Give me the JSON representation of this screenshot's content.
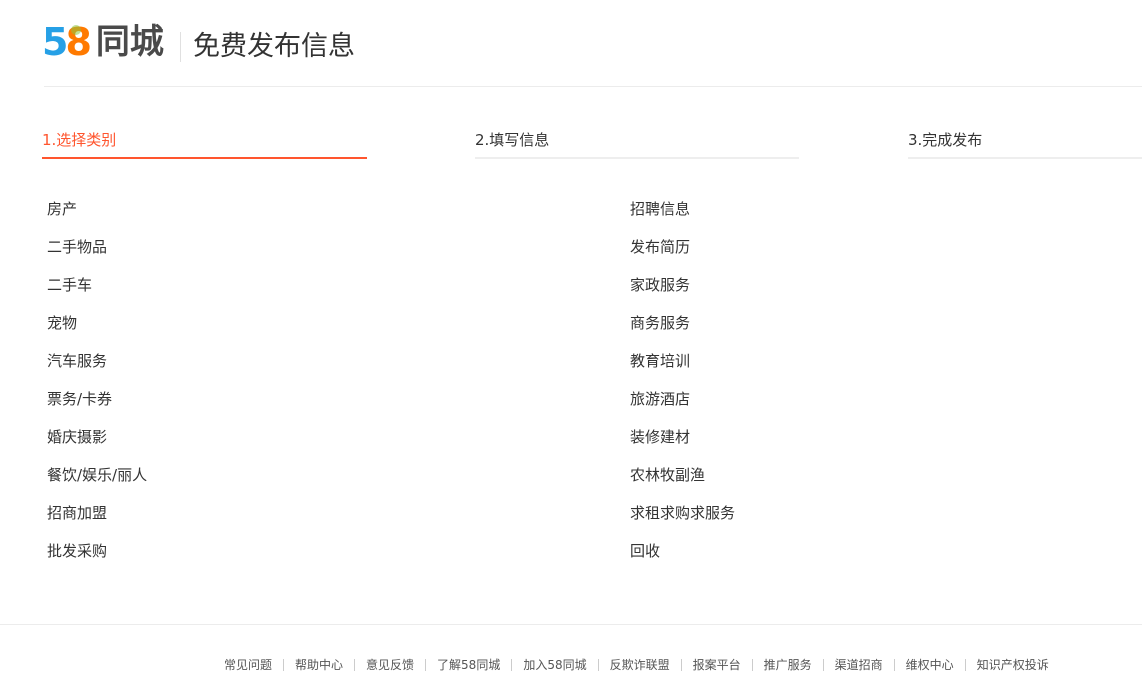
{
  "header": {
    "logo_number_1": "5",
    "logo_number_2": "8",
    "logo_text": "同城",
    "title": "免费发布信息"
  },
  "steps": [
    {
      "label": "1.选择类别",
      "active": true
    },
    {
      "label": "2.填写信息",
      "active": false
    },
    {
      "label": "3.完成发布",
      "active": false
    }
  ],
  "categories_left": [
    "房产",
    "二手物品",
    "二手车",
    "宠物",
    "汽车服务",
    "票务/卡券",
    "婚庆摄影",
    "餐饮/娱乐/丽人",
    "招商加盟",
    "批发采购"
  ],
  "categories_right": [
    "招聘信息",
    "发布简历",
    "家政服务",
    "商务服务",
    "教育培训",
    "旅游酒店",
    "装修建材",
    "农林牧副渔",
    "求租求购求服务",
    "回收"
  ],
  "footer": {
    "links": [
      "常见问题",
      "帮助中心",
      "意见反馈",
      "了解58同城",
      "加入58同城",
      "反欺诈联盟",
      "报案平台",
      "推广服务",
      "渠道招商",
      "维权中心",
      "知识产权投诉"
    ]
  },
  "colors": {
    "accent": "#ff552e",
    "logo_blue": "#26a0e6",
    "logo_orange": "#ff7a00",
    "text": "#333333"
  }
}
